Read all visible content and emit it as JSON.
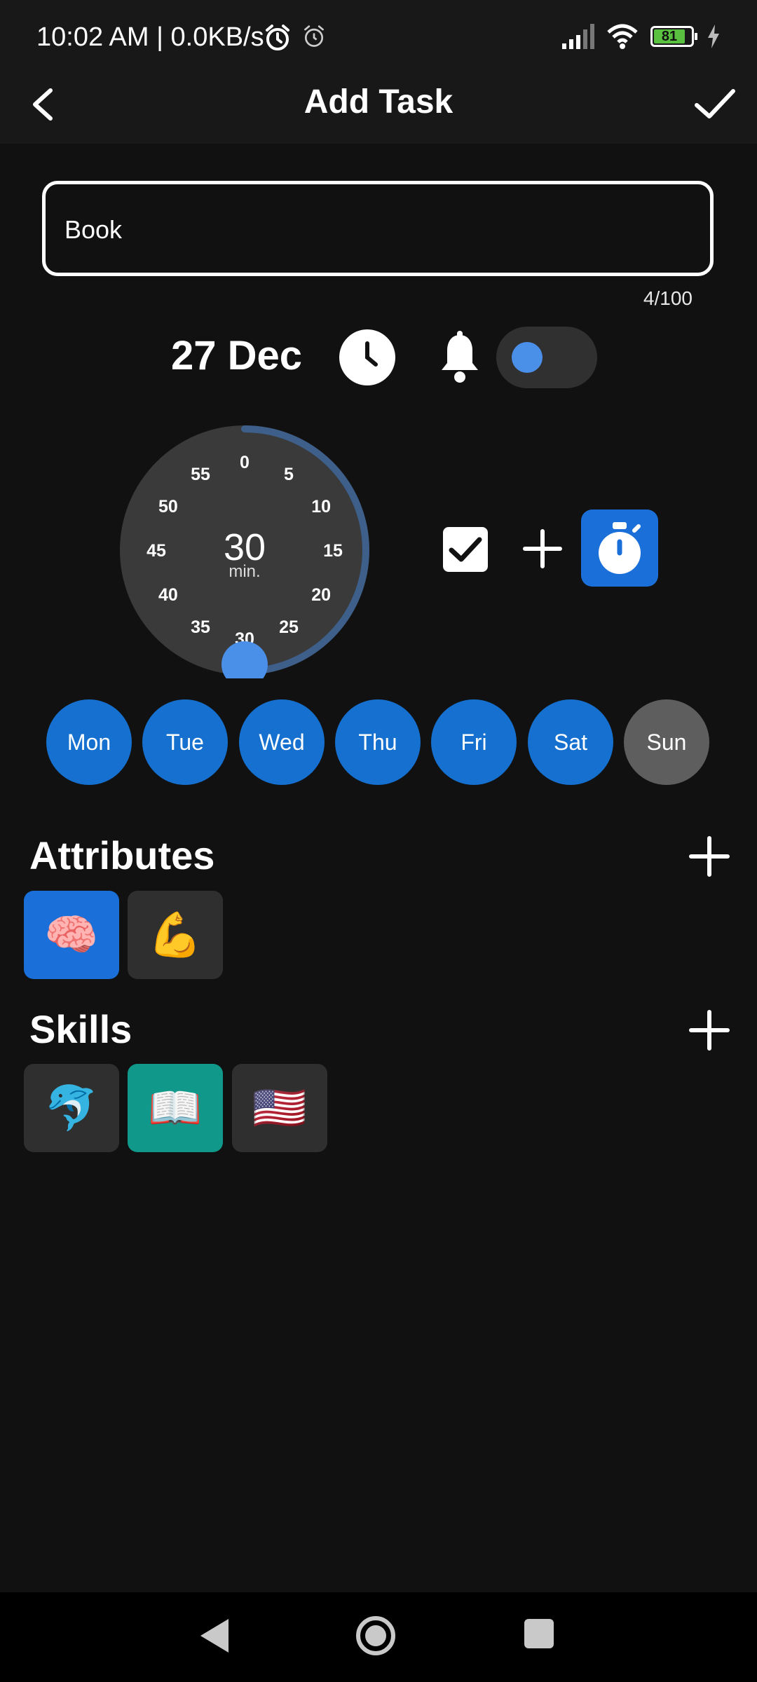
{
  "status": {
    "time": "10:02 AM | 0.0KB/s",
    "battery": "81"
  },
  "header": {
    "title": "Add Task"
  },
  "task": {
    "name_value": "Book",
    "counter": "4/100"
  },
  "schedule": {
    "date": "27 Dec"
  },
  "dial": {
    "value": "30",
    "unit": "min.",
    "progress_fraction": 0.5,
    "ticks": [
      "0",
      "5",
      "10",
      "15",
      "20",
      "25",
      "30",
      "35",
      "40",
      "45",
      "50",
      "55"
    ]
  },
  "days": [
    {
      "label": "Mon",
      "selected": true
    },
    {
      "label": "Tue",
      "selected": true
    },
    {
      "label": "Wed",
      "selected": true
    },
    {
      "label": "Thu",
      "selected": true
    },
    {
      "label": "Fri",
      "selected": true
    },
    {
      "label": "Sat",
      "selected": true
    },
    {
      "label": "Sun",
      "selected": false
    }
  ],
  "attributes": {
    "title": "Attributes",
    "items": [
      {
        "icon": "brain-icon",
        "emoji": "🧠",
        "selected": true
      },
      {
        "icon": "flexed-biceps-icon",
        "emoji": "💪",
        "selected": false
      }
    ]
  },
  "skills": {
    "title": "Skills",
    "items": [
      {
        "icon": "dolphin-icon",
        "emoji": "🐬",
        "selected": false
      },
      {
        "icon": "open-book-icon",
        "emoji": "📖",
        "selected": true
      },
      {
        "icon": "us-flag-icon",
        "emoji": "🇺🇸",
        "selected": false
      }
    ]
  },
  "colors": {
    "background": "#111111",
    "accent_blue": "#1570cf",
    "teal": "#10998a",
    "inactive_grey": "#5e5e5e"
  }
}
